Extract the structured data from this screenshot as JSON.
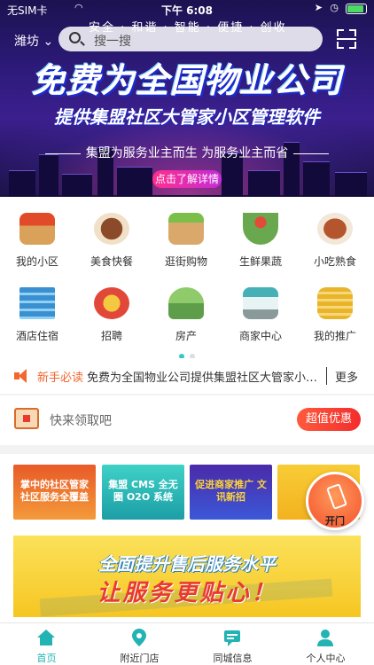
{
  "status_bar": {
    "carrier": "无SIM卡",
    "time": "下午 6:08"
  },
  "header": {
    "slogan": "安全 · 和谐 · 智能 · 便捷 · 创收",
    "city": "潍坊",
    "search_placeholder": "搜一搜"
  },
  "hero": {
    "headline": "免费为全国物业公司",
    "subheadline": "提供集盟社区大管家小区管理软件",
    "tagline": "集盟为服务业主而生 为服务业主而省",
    "cta": "点击了解详情"
  },
  "categories": [
    {
      "label": "我的小区",
      "icon": "house-icon",
      "color": "#c9813b"
    },
    {
      "label": "美食快餐",
      "icon": "food-bowl-icon",
      "color": "#8b4a2a"
    },
    {
      "label": "逛街购物",
      "icon": "shopping-bag-icon",
      "color": "#d9a86a"
    },
    {
      "label": "生鲜果蔬",
      "icon": "vegetable-basket-icon",
      "color": "#6aa84f"
    },
    {
      "label": "小吃熟食",
      "icon": "snack-plate-icon",
      "color": "#b5552d"
    },
    {
      "label": "酒店住宿",
      "icon": "hotel-icon",
      "color": "#3a8fd1"
    },
    {
      "label": "招聘",
      "icon": "recruit-icon",
      "color": "#e1483a"
    },
    {
      "label": "房产",
      "icon": "real-estate-icon",
      "color": "#5e9e4a"
    },
    {
      "label": "商家中心",
      "icon": "store-icon",
      "color": "#45b0b5"
    },
    {
      "label": "我的推广",
      "icon": "coins-icon",
      "color": "#e8b52a"
    }
  ],
  "notice": {
    "tag": "新手必读",
    "text": "免费为全国物业公司提供集盟社区大管家小区管理软件",
    "more": "更多"
  },
  "coupon": {
    "text": "快来领取吧",
    "button": "超值优惠"
  },
  "promos": [
    {
      "text": "掌中的社区管家 社区服务全覆盖"
    },
    {
      "text": "集盟 CMS 全无圈 O2O 系统"
    },
    {
      "text": "促进商家推广 文讯新招"
    },
    {
      "text": ""
    }
  ],
  "open_door": {
    "label": "开门"
  },
  "big_banner": {
    "line1": "全面提升售后服务水平",
    "line2": "让服务更贴心！"
  },
  "tabs": [
    {
      "label": "首页",
      "icon": "home-icon",
      "active": true
    },
    {
      "label": "附近门店",
      "icon": "location-pin-icon",
      "active": false
    },
    {
      "label": "同城信息",
      "icon": "message-board-icon",
      "active": false
    },
    {
      "label": "个人中心",
      "icon": "user-icon",
      "active": false
    }
  ],
  "colors": {
    "accent": "#24b3b3",
    "notice": "#f4662f",
    "coupon_button": "#f32d2d"
  }
}
